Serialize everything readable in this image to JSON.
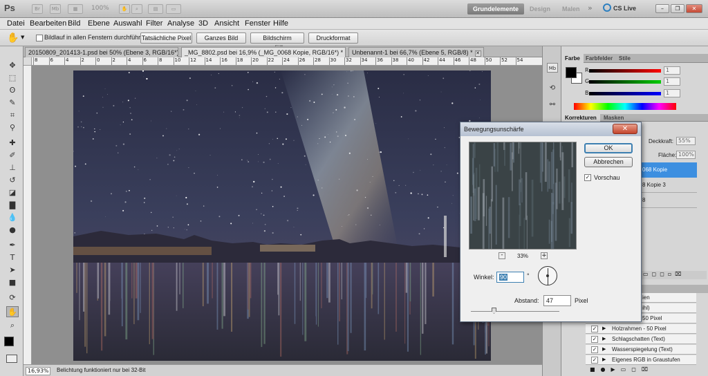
{
  "app": {
    "logo": "Ps",
    "zoom": "100%"
  },
  "workspaces": [
    "Grundelemente",
    "Design",
    "Malen"
  ],
  "cslive": "CS Live",
  "menu": [
    "Datei",
    "Bearbeiten",
    "Bild",
    "Ebene",
    "Auswahl",
    "Filter",
    "Analyse",
    "3D",
    "Ansicht",
    "Fenster",
    "Hilfe"
  ],
  "options": {
    "scroll_all_label": "Bildlauf in allen Fenstern durchführen",
    "buttons": [
      "Tatsächliche Pixel",
      "Ganzes Bild",
      "Bildschirm ausfüllen",
      "Druckformat"
    ]
  },
  "tabs": [
    {
      "label": "20150809_201413-1.psd bei 50% (Ebene 3, RGB/16*) *"
    },
    {
      "label": "_MG_8802.psd bei 16,9% (_MG_0068 Kopie, RGB/16*) *"
    },
    {
      "label": "Unbenannt-1 bei 66,7% (Ebene 5, RGB/8) *"
    }
  ],
  "ruler": [
    "8",
    "6",
    "4",
    "2",
    "0",
    "2",
    "4",
    "6",
    "8",
    "10",
    "12",
    "14",
    "16",
    "18",
    "20",
    "22",
    "24",
    "26",
    "28",
    "30",
    "32",
    "34",
    "36",
    "38",
    "40",
    "42",
    "44",
    "46",
    "48",
    "50",
    "52",
    "54"
  ],
  "status": {
    "zoom": "16,93%",
    "message": "Belichtung funktioniert nur bei 32-Bit"
  },
  "color_panel": {
    "tabs": [
      "Farbe",
      "Farbfelder",
      "Stile"
    ],
    "channels": [
      {
        "label": "R",
        "value": "1"
      },
      {
        "label": "G",
        "value": "1"
      },
      {
        "label": "B",
        "value": "1"
      }
    ]
  },
  "adjust_panel": {
    "tabs": [
      "Korrekturen",
      "Masken"
    ]
  },
  "layers_panel": {
    "opacity_label": "Deckkraft:",
    "opacity_value": "55%",
    "fill_label": "Fläche:",
    "fill_value": "100%",
    "layers": [
      {
        "name": "068 Kopie",
        "selected": true
      },
      {
        "name": "8 Kopie 3"
      },
      {
        "name": "8"
      }
    ]
  },
  "history_panel": {
    "items": [
      "ien",
      "ihl)",
      "50 Pixel",
      "Holzrahmen - 50 Pixel",
      "Schlagschatten (Text)",
      "Wasserspiegelung (Text)",
      "Eigenes RGB in Graustufen"
    ]
  },
  "dialog": {
    "title": "Bewegungsunschärfe",
    "ok": "OK",
    "cancel": "Abbrechen",
    "preview_label": "Vorschau",
    "preview_checked": "✓",
    "zoom": "33%",
    "zoom_out": "-",
    "zoom_in": "+",
    "angle_label": "Winkel:",
    "angle_value": "90",
    "angle_unit": "°",
    "distance_label": "Abstand:",
    "distance_value": "47",
    "distance_unit": "Pixel"
  },
  "colors": {
    "accent": "#3c7fb1",
    "selected_layer": "#3d8fe0"
  }
}
